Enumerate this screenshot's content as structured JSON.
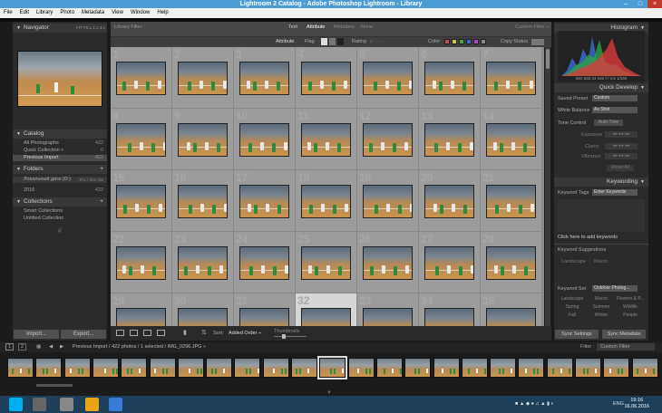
{
  "window": {
    "title": "Lightroom 2 Catalog - Adobe Photoshop Lightroom - Library",
    "controls": [
      "–",
      "□",
      "×"
    ]
  },
  "menu": [
    "File",
    "Edit",
    "Library",
    "Photo",
    "Metadata",
    "View",
    "Window",
    "Help"
  ],
  "left": {
    "navigator": {
      "title": "Navigator",
      "zoom": [
        "FIT",
        "FILL",
        "1:1",
        "3:1"
      ]
    },
    "catalog": {
      "title": "Catalog",
      "items": [
        {
          "label": "All Photographs",
          "count": "422"
        },
        {
          "label": "Quick Collection +",
          "count": "0"
        },
        {
          "label": "Previous Import",
          "count": "422"
        }
      ]
    },
    "folders": {
      "title": "Folders",
      "disk": {
        "label": "Локальный диск (D:)",
        "free": "871 / 931 GB"
      },
      "items": [
        {
          "label": "2016",
          "count": "422"
        }
      ]
    },
    "collections": {
      "title": "Collections",
      "items": [
        {
          "label": "Smart Collections"
        },
        {
          "label": "Untitled Collection"
        }
      ]
    },
    "import_label": "Import...",
    "export_label": "Export..."
  },
  "filter": {
    "title": "Library Filter :",
    "modes": [
      "Text",
      "Attribute",
      "Metadata",
      "None"
    ],
    "custom": "Custom Filter ÷",
    "attribute_label": "Attribute",
    "flag_label": "Flag",
    "rating_label": "Rating",
    "color_label": "Color",
    "copy_label": "Copy Status",
    "colors": [
      "#c44",
      "#cc4",
      "#4a4",
      "#46c",
      "#a4c",
      "#888"
    ]
  },
  "grid": {
    "numbers": [
      "1",
      "2",
      "3",
      "4",
      "5",
      "6",
      "7",
      "8",
      "9",
      "10",
      "11",
      "12",
      "13",
      "14",
      "15",
      "16",
      "17",
      "18",
      "19",
      "20",
      "21",
      "22",
      "23",
      "24",
      "25",
      "26",
      "27",
      "28",
      "29",
      "30",
      "31",
      "32",
      "33",
      "34",
      "35"
    ],
    "selected_index": 31
  },
  "toolbar": {
    "sort_label": "Sort:",
    "sort_value": "Added Order ÷",
    "thumbnails_label": "Thumbnails"
  },
  "right": {
    "histogram": {
      "title": "Histogram",
      "info": "ISO 640   24 mm   f / 4.5   1/160"
    },
    "quick_develop": {
      "title": "Quick Develop",
      "saved_preset_label": "Saved Preset",
      "saved_preset_value": "Custom",
      "white_balance_label": "White Balance",
      "white_balance_value": "As Shot",
      "tone_control_label": "Tone Control",
      "auto_tone": "Auto Tone",
      "rows": [
        "Exposure",
        "Clarity",
        "Vibrance"
      ],
      "reset_label": "Reset All"
    },
    "keywording": {
      "title": "Keywording",
      "tags_label": "Keyword Tags",
      "tags_value": "Enter Keywords",
      "add_hint": "Click here to add keywords",
      "suggestions_title": "Keyword Suggestions",
      "suggestions": [
        "Landscape",
        "Macro"
      ],
      "set_label": "Keyword Set",
      "set_value": "Outdoor Photog...",
      "set_items": [
        "Landscape",
        "Macro",
        "Flowers & P...",
        "Spring",
        "Summer",
        "Wildlife",
        "Fall",
        "Winter",
        "People"
      ]
    },
    "sync_settings": "Sync Settings",
    "sync_metadata": "Sync Metadata"
  },
  "filmstrip": {
    "pages": [
      "1",
      "2"
    ],
    "path": "Previous Import / 422 photos / 1 selected / IMG_0296.JPG ÷",
    "filter_label": "Filter :",
    "filter_value": "Custom Filter",
    "selected_index": 11
  },
  "taskbar": {
    "lang": "ENG",
    "time": "19:16",
    "date": "16.06.2016",
    "app_colors": [
      "#00aff0",
      "#666",
      "#888",
      "#e8a317",
      "#3a7bd5",
      "#e03a3a",
      "#3a3a3a"
    ]
  }
}
